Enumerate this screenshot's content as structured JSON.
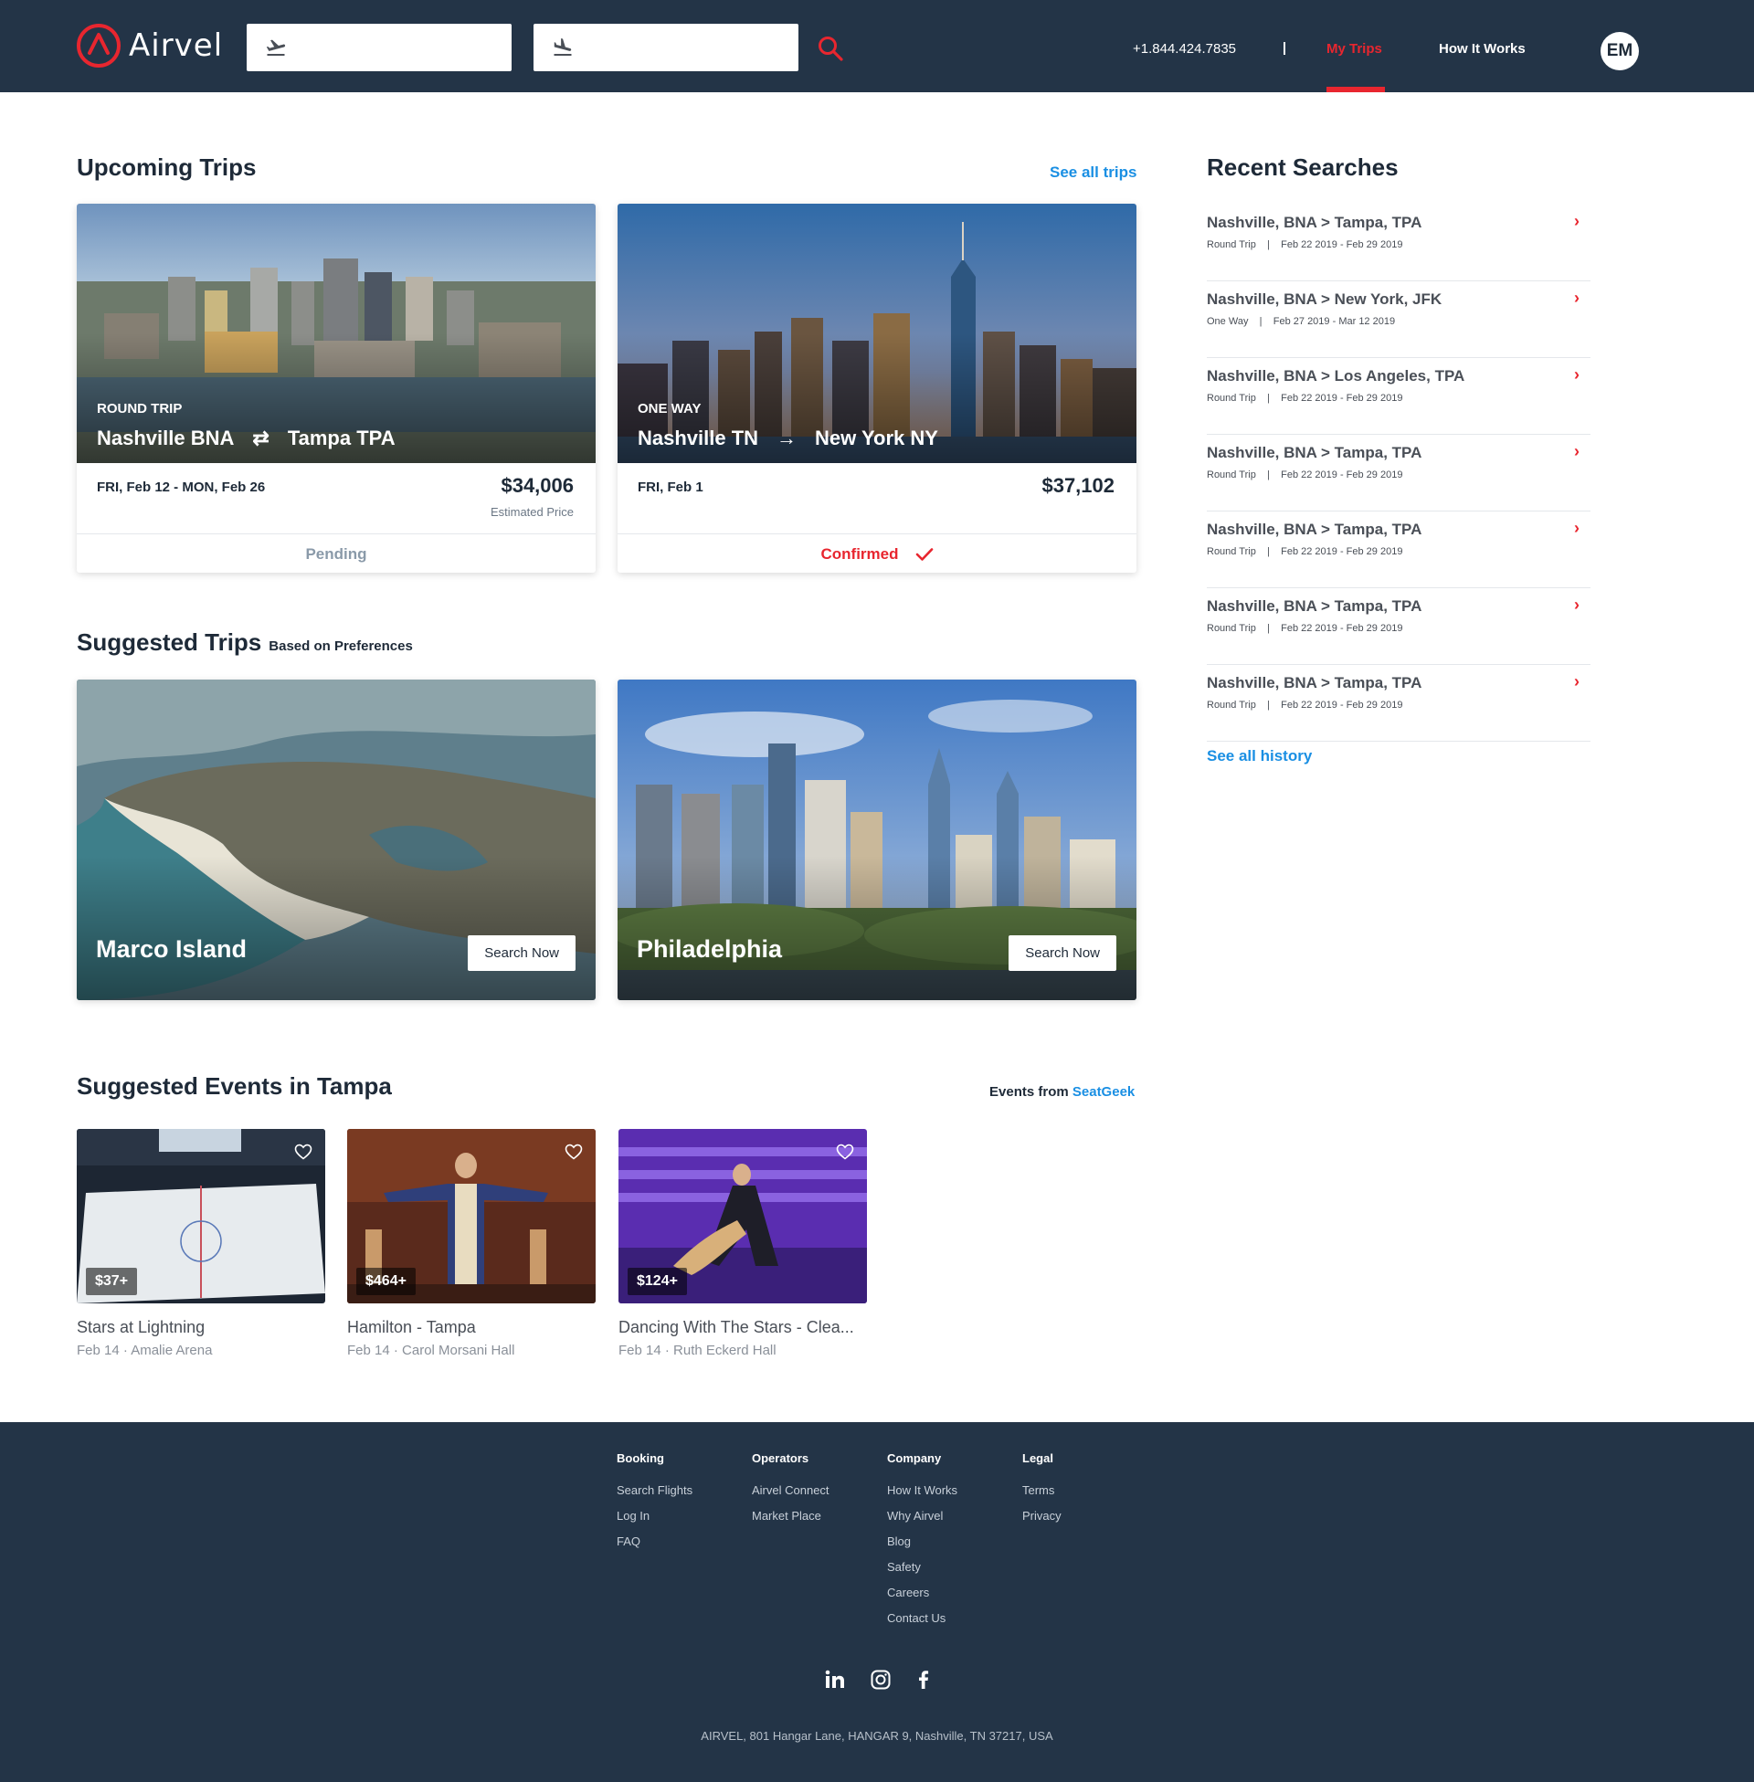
{
  "header": {
    "logo_text": "Airvel",
    "phone": "+1.844.424.7835",
    "nav_my_trips": "My Trips",
    "nav_how_it_works": "How It Works",
    "avatar_initials": "EM",
    "brand_color": "#e8262f",
    "header_bg": "#233447"
  },
  "upcoming": {
    "title": "Upcoming Trips",
    "see_all": "See all trips",
    "trips": [
      {
        "type": "ROUND TRIP",
        "from": "Nashville BNA",
        "to": "Tampa TPA",
        "dates": "FRI, Feb 12 - MON, Feb 26",
        "price": "$34,006",
        "price_note": "Estimated Price",
        "status": "Pending"
      },
      {
        "type": "ONE WAY",
        "from": "Nashville TN",
        "to": "New York NY",
        "dates": "FRI, Feb 1",
        "price": "$37,102",
        "price_note": "",
        "status": "Confirmed"
      }
    ]
  },
  "suggested": {
    "title": "Suggested Trips",
    "subtitle": "Based on Preferences",
    "items": [
      {
        "name": "Marco Island",
        "button": "Search Now"
      },
      {
        "name": "Philadelphia",
        "button": "Search Now"
      }
    ]
  },
  "events": {
    "title": "Suggested Events in Tampa",
    "source_prefix": "Events from",
    "source_name": "SeatGeek",
    "items": [
      {
        "price": "$37+",
        "title": "Stars at Lightning",
        "meta": "Feb 14 · Amalie Arena"
      },
      {
        "price": "$464+",
        "title": "Hamilton - Tampa",
        "meta": "Feb 14 · Carol Morsani Hall"
      },
      {
        "price": "$124+",
        "title": "Dancing With The Stars - Clea...",
        "meta": "Feb 14 · Ruth Eckerd Hall"
      }
    ]
  },
  "recent": {
    "title": "Recent Searches",
    "see_all": "See all history",
    "items": [
      {
        "route": "Nashville, BNA > Tampa, TPA",
        "trip": "Round Trip",
        "dates": "Feb 22 2019 - Feb 29 2019"
      },
      {
        "route": "Nashville, BNA > New York, JFK",
        "trip": "One Way",
        "dates": "Feb 27 2019 - Mar 12 2019"
      },
      {
        "route": "Nashville, BNA > Los Angeles, TPA",
        "trip": "Round Trip",
        "dates": "Feb 22 2019 - Feb 29 2019"
      },
      {
        "route": "Nashville, BNA > Tampa, TPA",
        "trip": "Round Trip",
        "dates": "Feb 22 2019 - Feb 29 2019"
      },
      {
        "route": "Nashville, BNA > Tampa, TPA",
        "trip": "Round Trip",
        "dates": "Feb 22 2019 - Feb 29 2019"
      },
      {
        "route": "Nashville, BNA > Tampa, TPA",
        "trip": "Round Trip",
        "dates": "Feb 22 2019 - Feb 29 2019"
      },
      {
        "route": "Nashville, BNA > Tampa, TPA",
        "trip": "Round Trip",
        "dates": "Feb 22 2019 - Feb 29 2019"
      }
    ]
  },
  "footer": {
    "columns": [
      {
        "heading": "Booking",
        "links": [
          "Search Flights",
          "Log In",
          "FAQ"
        ]
      },
      {
        "heading": "Operators",
        "links": [
          "Airvel Connect",
          "Market Place"
        ]
      },
      {
        "heading": "Company",
        "links": [
          "How It Works",
          "Why Airvel",
          "Blog",
          "Safety",
          "Careers",
          "Contact Us"
        ]
      },
      {
        "heading": "Legal",
        "links": [
          "Terms",
          "Privacy"
        ]
      }
    ],
    "social": [
      "linkedin-icon",
      "instagram-icon",
      "facebook-icon"
    ],
    "address": "AIRVEL, 801 Hangar Lane, HANGAR 9, Nashville, TN 37217, USA"
  }
}
